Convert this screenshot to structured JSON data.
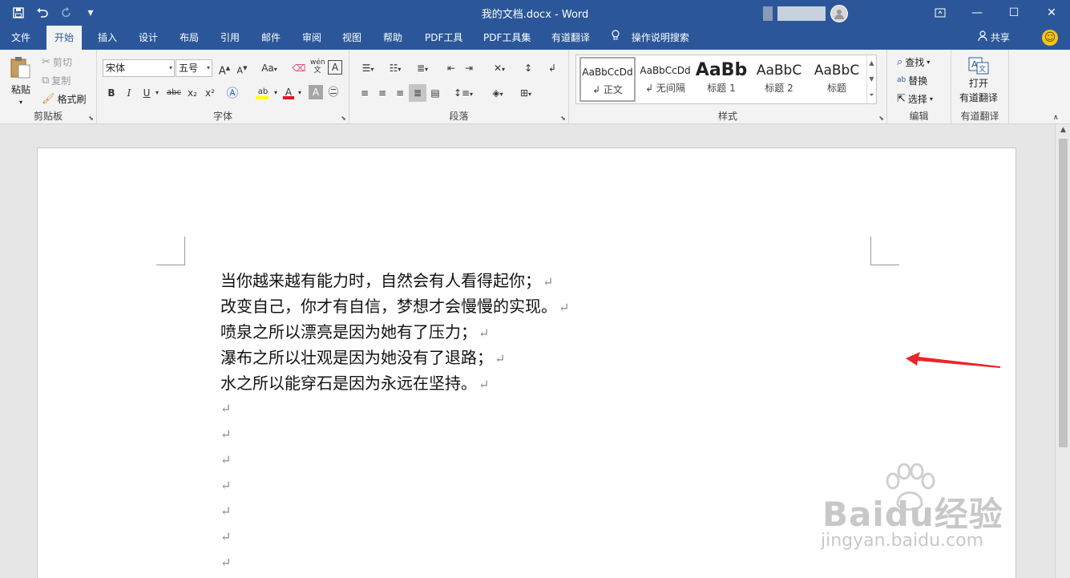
{
  "window": {
    "title": "我的文档.docx  -  Word",
    "restore_icon": "ribbon-display-icon",
    "minimize": "—",
    "maximize": "☐",
    "close": "✕"
  },
  "qat": {
    "save": "save-icon",
    "undo": "undo-icon",
    "redo": "redo-icon",
    "customize": "▾"
  },
  "tabs": [
    {
      "label": "文件"
    },
    {
      "label": "开始"
    },
    {
      "label": "插入"
    },
    {
      "label": "设计"
    },
    {
      "label": "布局"
    },
    {
      "label": "引用"
    },
    {
      "label": "邮件"
    },
    {
      "label": "审阅"
    },
    {
      "label": "视图"
    },
    {
      "label": "帮助"
    },
    {
      "label": "PDF工具"
    },
    {
      "label": "PDF工具集"
    },
    {
      "label": "有道翻译"
    }
  ],
  "tell_me": "操作说明搜索",
  "share": "共享",
  "ribbon": {
    "clipboard": {
      "label": "剪贴板",
      "paste": "粘贴",
      "cut": "剪切",
      "copy": "复制",
      "format_painter": "格式刷"
    },
    "font": {
      "label": "字体",
      "font_name": "宋体",
      "font_size": "五号",
      "grow": "A",
      "shrink": "A",
      "case": "Aa",
      "bold": "B",
      "italic": "I",
      "underline": "U",
      "strike": "abc",
      "sub": "x₂",
      "super": "x²",
      "font_color_accent": "#e81123",
      "highlight_accent": "#ffff00"
    },
    "paragraph": {
      "label": "段落"
    },
    "styles": {
      "label": "样式",
      "items": [
        {
          "sample": "AaBbCcDd",
          "name": "↲ 正文"
        },
        {
          "sample": "AaBbCcDd",
          "name": "↲ 无间隔"
        },
        {
          "sample": "AaBb",
          "name": "标题 1"
        },
        {
          "sample": "AaBbC",
          "name": "标题 2"
        },
        {
          "sample": "AaBbC",
          "name": "标题"
        }
      ]
    },
    "editing": {
      "label": "编辑",
      "find": "查找",
      "replace": "替换",
      "select": "选择"
    },
    "youdao": {
      "label": "有道翻译",
      "open": "打开",
      "open2": "有道翻译"
    }
  },
  "document": {
    "lines": [
      "当你越来越有能力时，自然会有人看得起你；",
      "改变自己，你才有自信，梦想才会慢慢的实现。",
      "喷泉之所以漂亮是因为她有了压力；",
      "瀑布之所以壮观是因为她没有了退路；",
      "水之所以能穿石是因为永远在坚持。"
    ],
    "para_mark": "↵",
    "empty_paragraphs": 7
  },
  "watermark": {
    "main": "Baidu经验",
    "sub": "jingyan.baidu.com"
  },
  "colors": {
    "titlebar": "#2b579a",
    "annotation_arrow": "#e8262a"
  }
}
